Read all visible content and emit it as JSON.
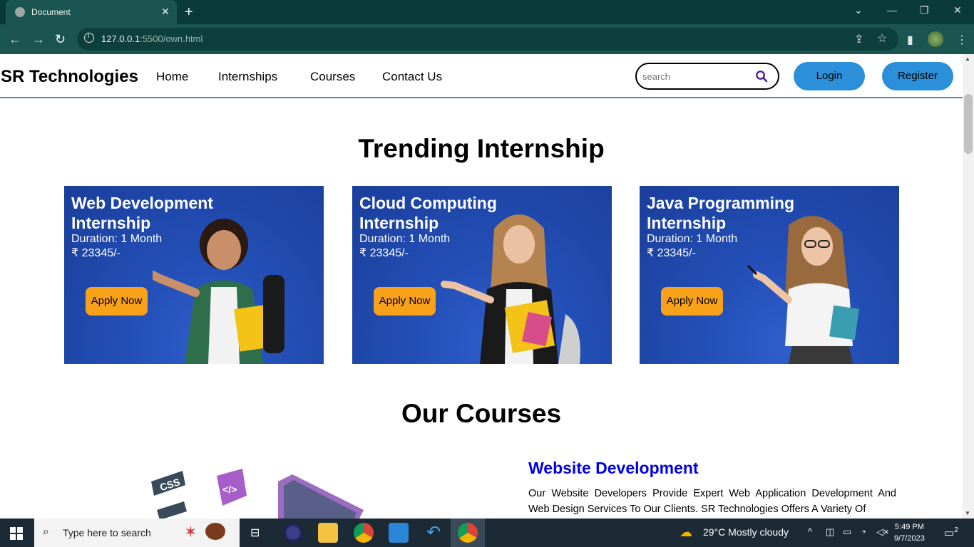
{
  "browser": {
    "tab_title": "Document",
    "tab_close": "✕",
    "new_tab": "+",
    "url_host": "127.0.0.1",
    "url_rest": ":5500/own.html",
    "window_controls": [
      "⌄",
      "—",
      "❐",
      "✕"
    ]
  },
  "site": {
    "brand": "SR Technologies",
    "nav": [
      "Home",
      "Internships",
      "Courses",
      "Contact Us"
    ],
    "search_placeholder": "search",
    "login": "Login",
    "register": "Register"
  },
  "trending": {
    "title": "Trending Internship",
    "cards": [
      {
        "title": "Web Development Internship",
        "duration": "Duration: 1 Month",
        "price": "₹ 23345/-",
        "button": "Apply Now"
      },
      {
        "title": "Cloud Computing Internship",
        "duration": "Duration: 1 Month",
        "price": "₹ 23345/-",
        "button": "Apply Now"
      },
      {
        "title": "Java Programming Internship",
        "duration": "Duration: 1 Month",
        "price": "₹ 23345/-",
        "button": "Apply Now"
      }
    ]
  },
  "courses": {
    "title": "Our Courses",
    "first_course_title": "Website Development",
    "first_course_desc": "Our Website Developers Provide Expert Web Application Development And Web Design Services To Our Clients. SR Technologies Offers A Variety Of"
  },
  "taskbar": {
    "search_text": "Type here to search",
    "weather": "29°C  Mostly cloudy",
    "time": "5:49 PM",
    "date": "9/7/2023",
    "notification_count": "2"
  },
  "colors": {
    "browser_frame": "#0b3b38",
    "browser_toolbar": "#1a5552",
    "nav_underline": "#3d8cbc",
    "button_blue": "#2b90d9",
    "apply_orange": "#f8a21a",
    "card_blue": "#2450b8",
    "course_title_blue": "#0000e6"
  }
}
